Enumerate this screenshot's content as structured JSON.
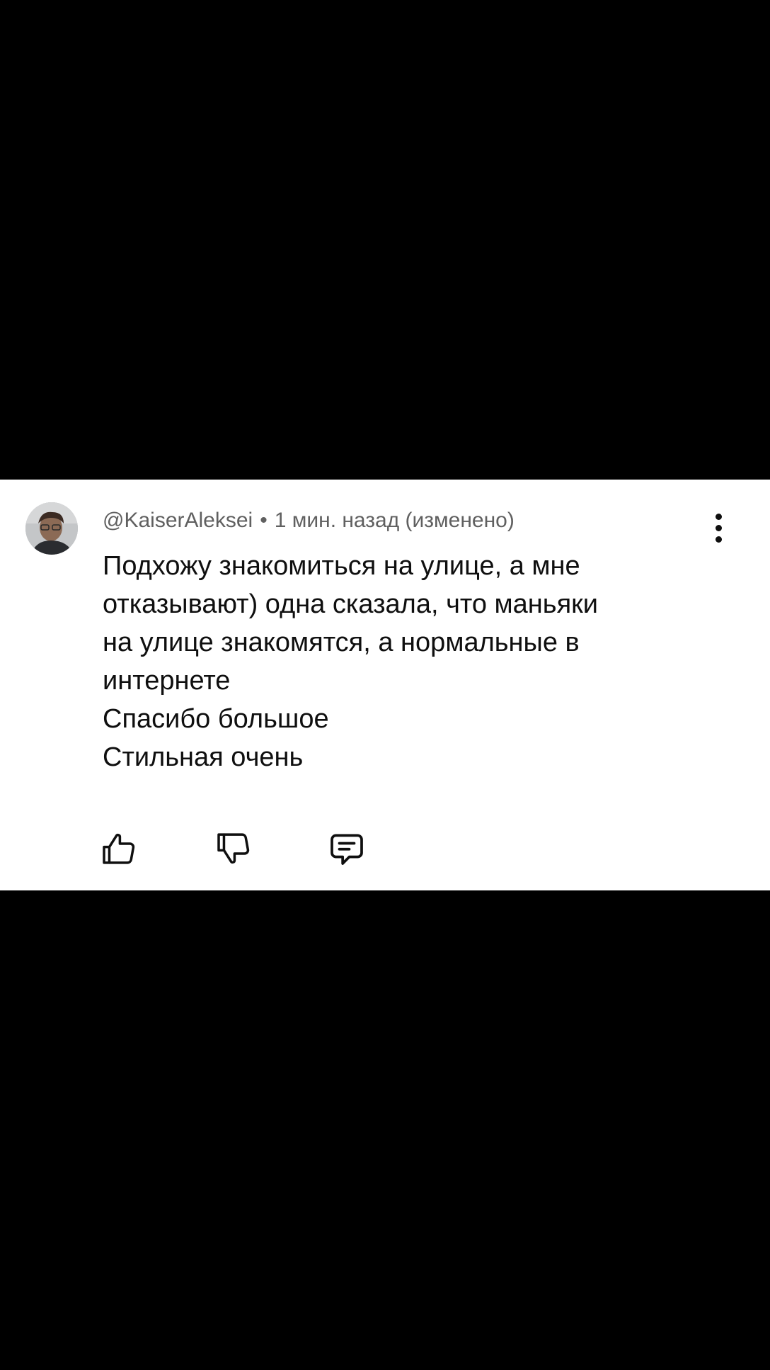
{
  "comment": {
    "author": "@KaiserAleksei",
    "separator": "•",
    "time": "1 мин. назад (изменено)",
    "lines": [
      "Подхожу знакомиться на улице, а мне",
      "отказывают) одна сказала, что маньяки",
      "на улице знакомятся, а нормальные в",
      "интернете",
      "Спасибо большое",
      "Стильная очень"
    ]
  },
  "icons": {
    "like": "thumbs-up-icon",
    "dislike": "thumbs-down-icon",
    "reply": "reply-comment-icon",
    "more": "more-vert-icon"
  },
  "colors": {
    "background": "#000000",
    "card": "#ffffff",
    "text": "#0f0f0f",
    "meta": "#606060"
  }
}
